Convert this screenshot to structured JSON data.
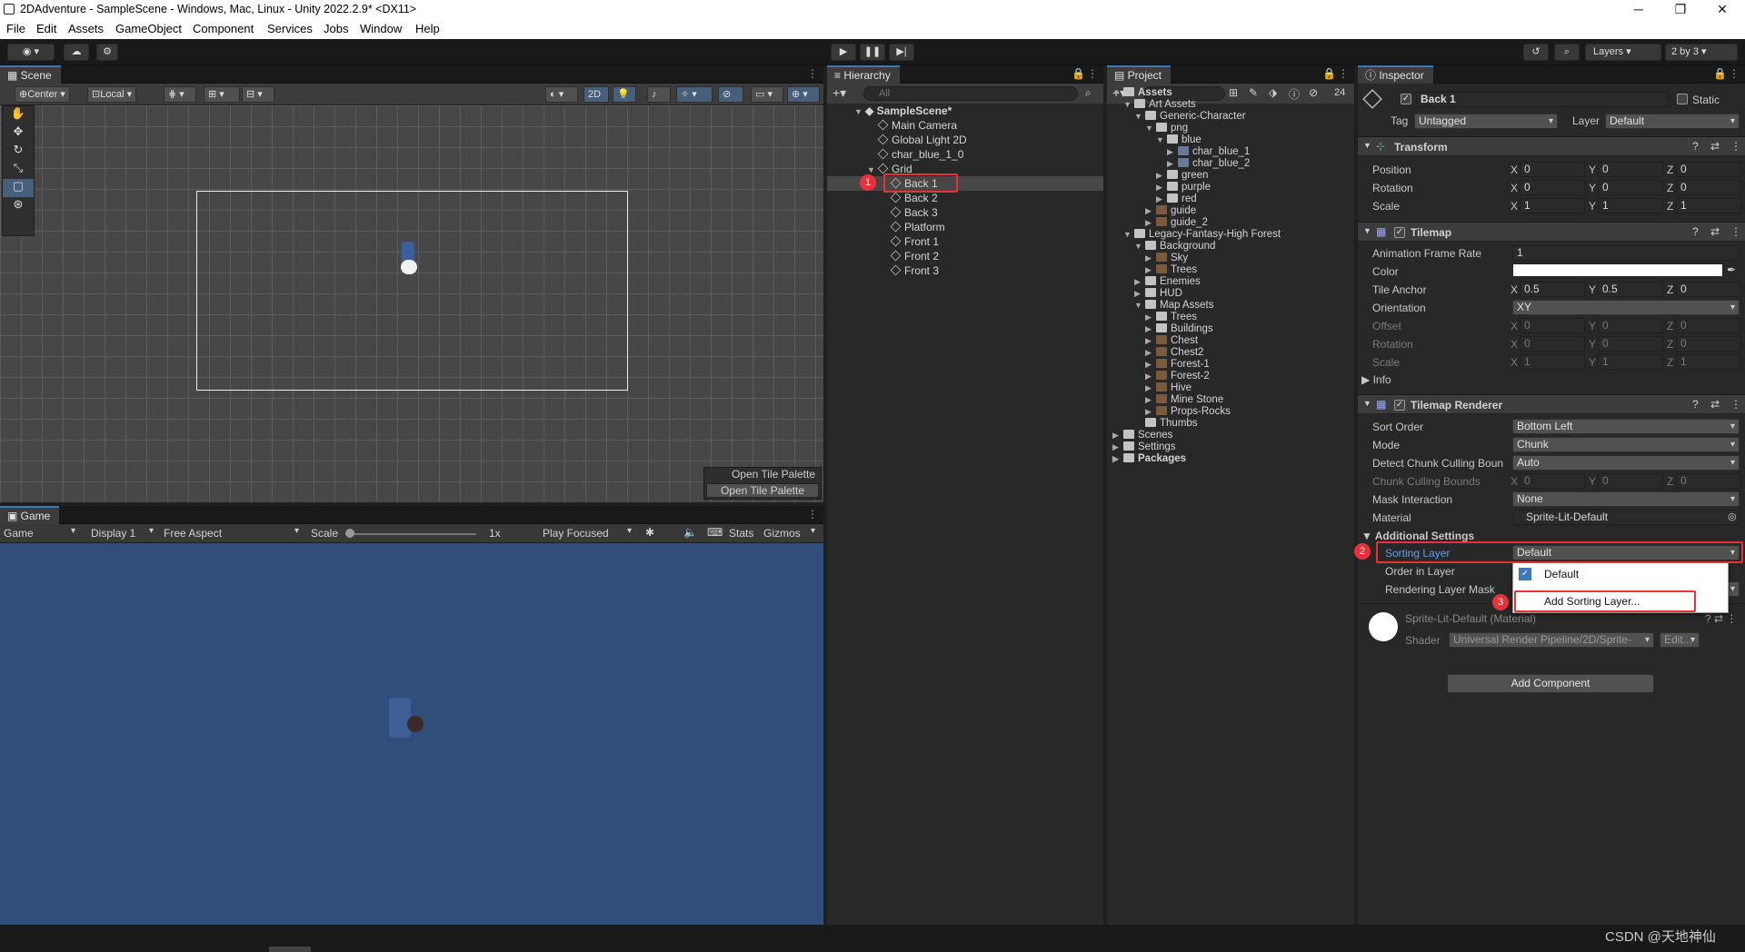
{
  "window": {
    "title": "2DAdventure - SampleScene - Windows, Mac, Linux - Unity 2022.2.9* <DX11>",
    "min": "─",
    "max": "❐",
    "close": "✕"
  },
  "menu": [
    "File",
    "Edit",
    "Assets",
    "GameObject",
    "Component",
    "Services",
    "Jobs",
    "Window",
    "Help"
  ],
  "toolbar": {
    "layers": "Layers",
    "layout": "2 by 3"
  },
  "scene": {
    "tab": "Scene",
    "pivot": "Center",
    "space": "Local",
    "mode2d": "2D",
    "open_tile_palette_title": "Open Tile Palette",
    "open_tile_palette_btn": "Open Tile Palette"
  },
  "game": {
    "tab": "Game",
    "view": "Game",
    "display": "Display 1",
    "aspect": "Free Aspect",
    "scale_label": "Scale",
    "scale_value": "1x",
    "play_mode": "Play Focused",
    "stats": "Stats",
    "gizmos": "Gizmos"
  },
  "hierarchy": {
    "tab": "Hierarchy",
    "search": "All",
    "scene": "SampleScene*",
    "items": [
      "Main Camera",
      "Global Light 2D",
      "char_blue_1_0",
      "Grid",
      "Back 1",
      "Back 2",
      "Back 3",
      "Platform",
      "Front 1",
      "Front 2",
      "Front 3"
    ]
  },
  "project": {
    "tab": "Project",
    "count": "24",
    "rows": [
      "Assets",
      "Art Assets",
      "Generic-Character",
      "png",
      "blue",
      "char_blue_1",
      "char_blue_2",
      "green",
      "purple",
      "red",
      "guide",
      "guide_2",
      "Legacy-Fantasy-High Forest",
      "Background",
      "Sky",
      "Trees",
      "Enemies",
      "HUD",
      "Map Assets",
      "Trees",
      "Buildings",
      "Chest",
      "Chest2",
      "Forest-1",
      "Forest-2",
      "Hive",
      "Mine Stone",
      "Props-Rocks",
      "Thumbs",
      "Scenes",
      "Settings",
      "Packages"
    ]
  },
  "inspector": {
    "tab": "Inspector",
    "object_name": "Back 1",
    "static": "Static",
    "tag_label": "Tag",
    "tag": "Untagged",
    "layer_label": "Layer",
    "layer": "Default",
    "transform": {
      "title": "Transform",
      "position": "Position",
      "rotation": "Rotation",
      "scale": "Scale",
      "pos": [
        "0",
        "0",
        "0"
      ],
      "rot": [
        "0",
        "0",
        "0"
      ],
      "scl": [
        "1",
        "1",
        "1"
      ]
    },
    "tilemap": {
      "title": "Tilemap",
      "anim_rate_label": "Animation Frame Rate",
      "anim_rate": "1",
      "color_label": "Color",
      "tile_anchor_label": "Tile Anchor",
      "anchor": [
        "0.5",
        "0.5",
        "0"
      ],
      "orientation_label": "Orientation",
      "orientation": "XY",
      "offset_label": "Offset",
      "offset": [
        "0",
        "0",
        "0"
      ],
      "rotation_label": "Rotation",
      "rotation": [
        "0",
        "0",
        "0"
      ],
      "scale_label": "Scale",
      "scale": [
        "1",
        "1",
        "1"
      ],
      "info": "Info"
    },
    "renderer": {
      "title": "Tilemap Renderer",
      "sort_order_label": "Sort Order",
      "sort_order": "Bottom Left",
      "mode_label": "Mode",
      "mode": "Chunk",
      "detect_label": "Detect Chunk Culling Boun",
      "detect": "Auto",
      "bounds_label": "Chunk Culling Bounds",
      "bounds": [
        "0",
        "0",
        "0"
      ],
      "mask_label": "Mask Interaction",
      "mask": "None",
      "material_label": "Material",
      "material": "Sprite-Lit-Default",
      "additional": "Additional Settings",
      "sorting_layer_label": "Sorting Layer",
      "sorting_layer": "Default",
      "order_label": "Order in Layer",
      "rendering_mask_label": "Rendering Layer Mask"
    },
    "popup": {
      "option_default": "Default",
      "option_add": "Add Sorting Layer..."
    },
    "material": {
      "name": "Sprite-Lit-Default (Material)",
      "shader_label": "Shader",
      "shader": "Universal Render Pipeline/2D/Sprite-",
      "edit": "Edit..."
    },
    "add_component": "Add Component"
  },
  "badges": [
    "1",
    "2",
    "3"
  ],
  "watermark": "CSDN @天地神仙",
  "colors": {
    "accent": "#3a79bb",
    "highlight": "#e8323a",
    "game_bg": "#314d79"
  }
}
